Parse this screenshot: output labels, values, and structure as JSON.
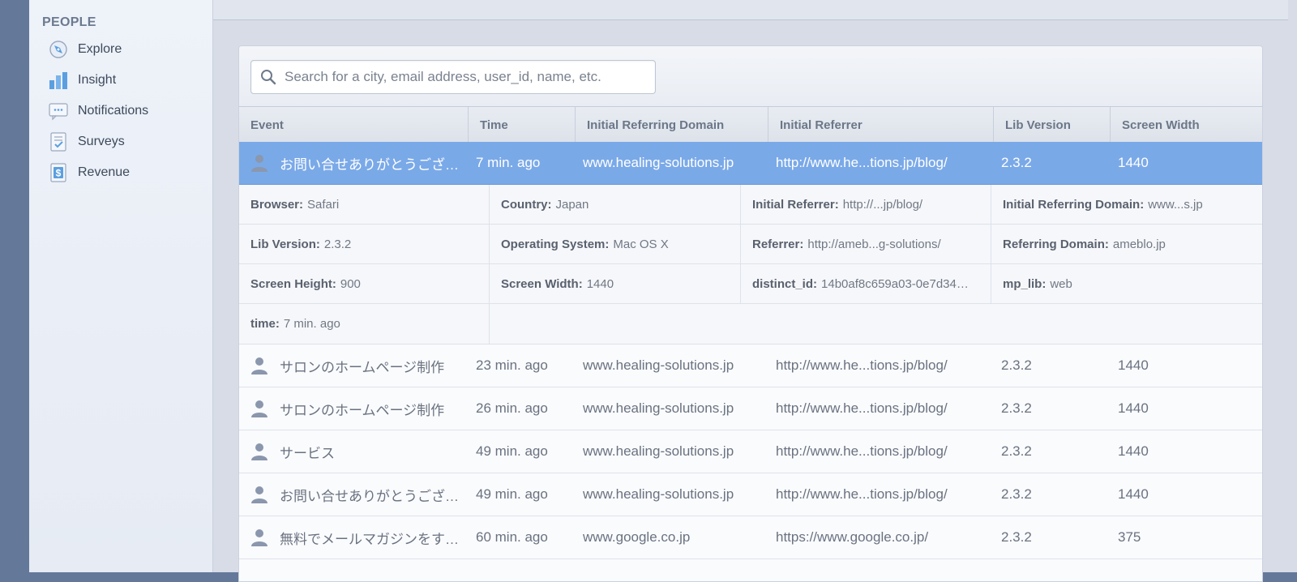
{
  "sidebar": {
    "heading": "PEOPLE",
    "items": [
      {
        "label": "Explore",
        "icon": "compass-icon"
      },
      {
        "label": "Insight",
        "icon": "bar-chart-icon"
      },
      {
        "label": "Notifications",
        "icon": "chat-bubble-icon"
      },
      {
        "label": "Surveys",
        "icon": "checklist-icon"
      },
      {
        "label": "Revenue",
        "icon": "dollar-icon"
      }
    ]
  },
  "search": {
    "placeholder": "Search for a city, email address, user_id, name, etc."
  },
  "table": {
    "columns": [
      "Event",
      "Time",
      "Initial Referring Domain",
      "Initial Referrer",
      "Lib Version",
      "Screen Width"
    ],
    "selected_row": {
      "event": "お問い合せありがとうござ…",
      "time": "7 min. ago",
      "domain": "www.healing-solutions.jp",
      "referrer": "http://www.he...tions.jp/blog/",
      "lib": "2.3.2",
      "width": "1440"
    },
    "details": [
      [
        {
          "k": "Browser:",
          "v": "Safari"
        },
        {
          "k": "Country:",
          "v": "Japan"
        },
        {
          "k": "Initial Referrer:",
          "v": "http://...jp/blog/"
        },
        {
          "k": "Initial Referring Domain:",
          "v": "www...s.jp"
        }
      ],
      [
        {
          "k": "Lib Version:",
          "v": "2.3.2"
        },
        {
          "k": "Operating System:",
          "v": "Mac OS X"
        },
        {
          "k": "Referrer:",
          "v": "http://ameb...g-solutions/"
        },
        {
          "k": "Referring Domain:",
          "v": "ameblo.jp"
        }
      ],
      [
        {
          "k": "Screen Height:",
          "v": "900"
        },
        {
          "k": "Screen Width:",
          "v": "1440"
        },
        {
          "k": "distinct_id:",
          "v": "14b0af8c659a03-0e7d34…"
        },
        {
          "k": "mp_lib:",
          "v": "web"
        }
      ],
      [
        {
          "k": "time:",
          "v": "7 min. ago"
        }
      ]
    ],
    "rows": [
      {
        "event": "サロンのホームページ制作",
        "time": "23 min. ago",
        "domain": "www.healing-solutions.jp",
        "referrer": "http://www.he...tions.jp/blog/",
        "lib": "2.3.2",
        "width": "1440"
      },
      {
        "event": "サロンのホームページ制作",
        "time": "26 min. ago",
        "domain": "www.healing-solutions.jp",
        "referrer": "http://www.he...tions.jp/blog/",
        "lib": "2.3.2",
        "width": "1440"
      },
      {
        "event": "サービス",
        "time": "49 min. ago",
        "domain": "www.healing-solutions.jp",
        "referrer": "http://www.he...tions.jp/blog/",
        "lib": "2.3.2",
        "width": "1440"
      },
      {
        "event": "お問い合せありがとうござ…",
        "time": "49 min. ago",
        "domain": "www.healing-solutions.jp",
        "referrer": "http://www.he...tions.jp/blog/",
        "lib": "2.3.2",
        "width": "1440"
      },
      {
        "event": "無料でメールマガジンをす…",
        "time": "60 min. ago",
        "domain": "www.google.co.jp",
        "referrer": "https://www.google.co.jp/",
        "lib": "2.3.2",
        "width": "375"
      }
    ]
  },
  "colors": {
    "selected_row": "#7aa9e8",
    "page_background": "#64789a",
    "accent_icon": "#5b9fe0"
  },
  "icons": {
    "person": "person-icon",
    "search": "search-icon"
  }
}
